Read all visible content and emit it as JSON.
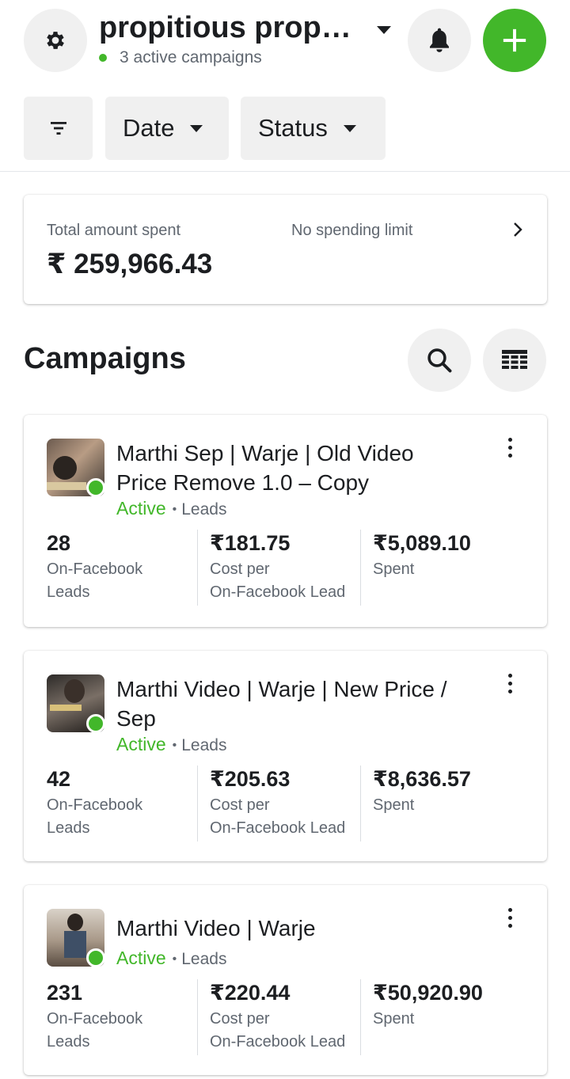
{
  "header": {
    "account_name": "propitious prope…",
    "active_campaigns_text": "3 active campaigns"
  },
  "filters": {
    "date_label": "Date",
    "status_label": "Status"
  },
  "spend_summary": {
    "label": "Total amount spent",
    "limit_text": "No spending limit",
    "amount": "₹ 259,966.43"
  },
  "campaigns_section": {
    "title": "Campaigns"
  },
  "campaigns": [
    {
      "name": "Marthi Sep | Warje | Old Video Price Remove 1.0 – Copy",
      "status": "Active",
      "objective": "Leads",
      "results": "28",
      "results_label_1": "On-Facebook",
      "results_label_2": "Leads",
      "cost": "₹181.75",
      "cost_label_1": "Cost per",
      "cost_label_2": "On-Facebook Lead",
      "spent": "₹5,089.10",
      "spent_label": "Spent"
    },
    {
      "name": "Marthi Video | Warje | New Price / Sep",
      "status": "Active",
      "objective": "Leads",
      "results": "42",
      "results_label_1": "On-Facebook",
      "results_label_2": "Leads",
      "cost": "₹205.63",
      "cost_label_1": "Cost per",
      "cost_label_2": "On-Facebook Lead",
      "spent": "₹8,636.57",
      "spent_label": "Spent"
    },
    {
      "name": "Marthi Video | Warje",
      "status": "Active",
      "objective": "Leads",
      "results": "231",
      "results_label_1": "On-Facebook",
      "results_label_2": "Leads",
      "cost": "₹220.44",
      "cost_label_1": "Cost per",
      "cost_label_2": "On-Facebook Lead",
      "spent": "₹50,920.90",
      "spent_label": "Spent"
    }
  ],
  "colors": {
    "accent_green": "#42b72a",
    "text_primary": "#1c1e21",
    "text_secondary": "#606770",
    "button_bg": "#f0f0f0"
  },
  "icons": [
    "gear-icon",
    "caret-down-icon",
    "bell-icon",
    "plus-icon",
    "filter-icon",
    "chevron-right-icon",
    "search-icon",
    "columns-icon",
    "more-vertical-icon"
  ]
}
